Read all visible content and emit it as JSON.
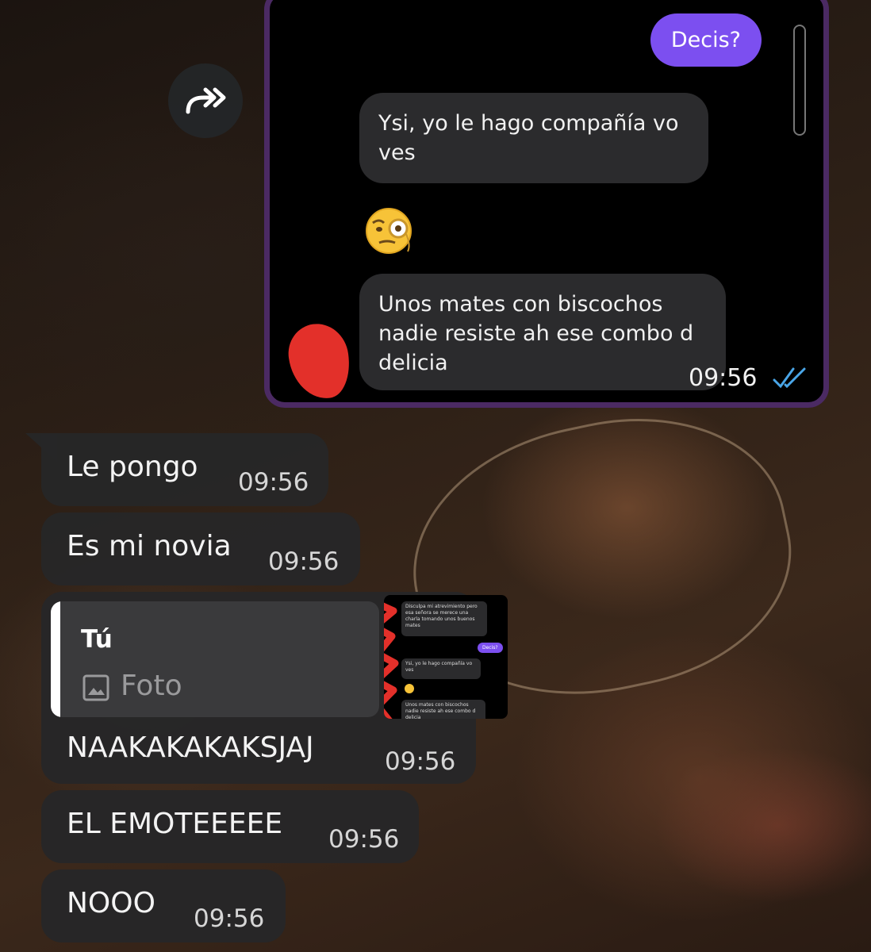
{
  "forward": {
    "icon": "forward-arrow-icon"
  },
  "screenshot": {
    "sent_message": "Decis?",
    "received_1": "Ysi, yo le hago compañía vo ves",
    "emoji": "monocle-face-emoji",
    "received_2": "Unos mates con biscochos nadie resiste ah ese combo d delicia",
    "time": "09:56",
    "status_icon": "double-check-icon",
    "colors": {
      "border": "#4b2a63",
      "sent_bubble": "#7c4ff0",
      "redaction": "#e3302a"
    }
  },
  "messages": [
    {
      "text": "Le pongo",
      "time": "09:56"
    },
    {
      "text": "Es mi novia",
      "time": "09:56"
    },
    {
      "text": "NAAKAKAKAKSJAJ",
      "time": "09:56"
    },
    {
      "text": "EL EMOTEEEEE",
      "time": "09:56"
    },
    {
      "text": "NOOO",
      "time": "09:56"
    }
  ],
  "reply": {
    "author": "Tú",
    "type": "Foto",
    "icon": "image-icon",
    "thumbnail": {
      "msg_1": "Disculpa mi atrevimiento pero esa señora se merece una charla tomando unos buenos mates",
      "sent": "Decis?",
      "msg_2": "Ysi, yo le hago compañía vo ves",
      "msg_3": "Unos mates con biscochos nadie resiste ah ese combo d delicia"
    }
  }
}
